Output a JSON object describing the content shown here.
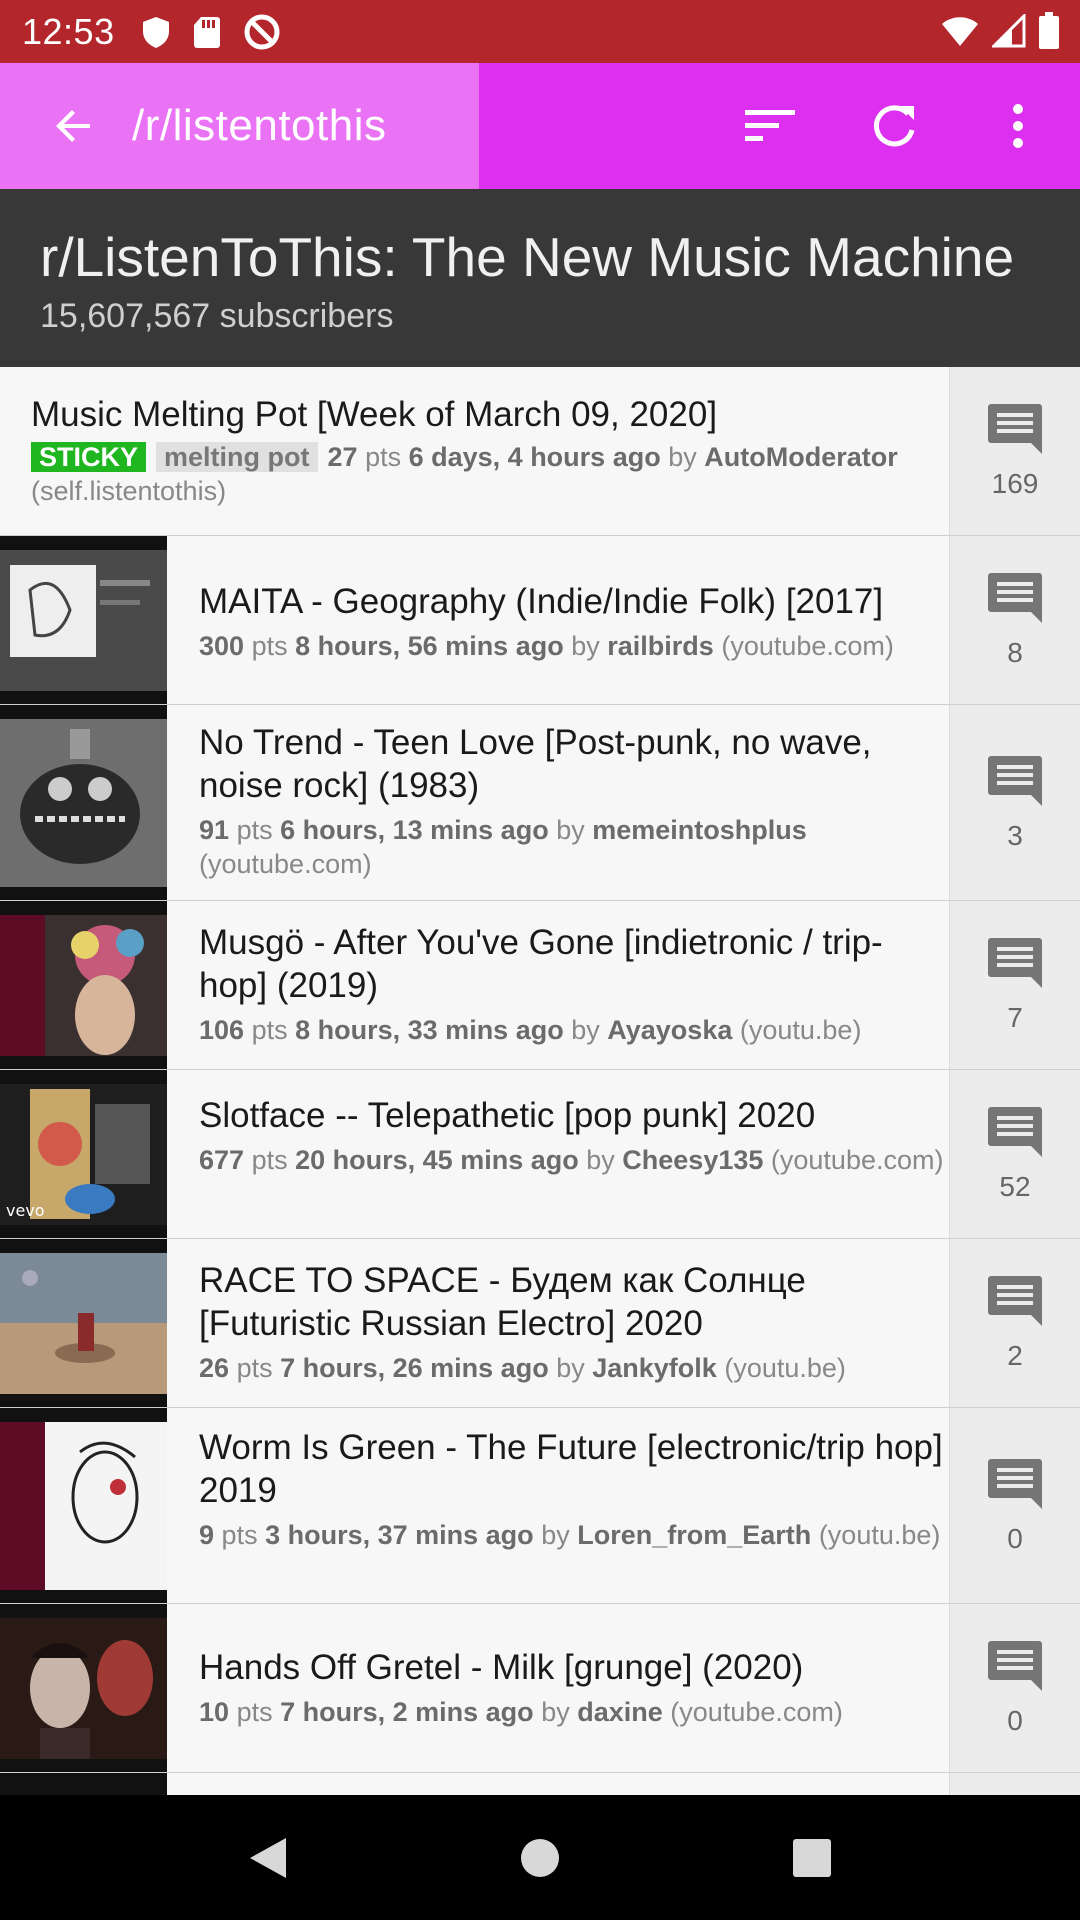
{
  "status_bar": {
    "time": "12:53"
  },
  "app_bar": {
    "title": "/r/listentothis"
  },
  "subreddit": {
    "title": "r/ListenToThis: The New Music Machine",
    "subscribers": "15,607,567 subscribers"
  },
  "posts": [
    {
      "title": "Music Melting Pot [Week of March 09, 2020]",
      "tag": "STICKY",
      "flair": "melting pot",
      "points": "27",
      "pts_label": "pts",
      "time": "6 days, 4 hours ago",
      "by": "by",
      "author": "AutoModerator",
      "domain": "(self.listentothis)",
      "comments": "169"
    },
    {
      "title": "MAITA - Geography (Indie/Indie Folk) [2017]",
      "points": "300",
      "pts_label": "pts",
      "time": "8 hours, 56 mins ago",
      "by": "by",
      "author": "railbirds",
      "domain": "(youtube.com)",
      "comments": "8"
    },
    {
      "title": "No Trend - Teen Love [Post-punk, no wave, noise rock] (1983)",
      "points": "91",
      "pts_label": "pts",
      "time": "6 hours, 13 mins ago",
      "by": "by",
      "author": "memeintoshplus",
      "domain": "(youtube.com)",
      "comments": "3"
    },
    {
      "title": "Musgö - After You've Gone [indietronic / trip-hop] (2019)",
      "points": "106",
      "pts_label": "pts",
      "time": "8 hours, 33 mins ago",
      "by": "by",
      "author": "Ayayoska",
      "domain": "(youtu.be)",
      "comments": "7"
    },
    {
      "title": "Slotface -- Telepathetic [pop punk] 2020",
      "points": "677",
      "pts_label": "pts",
      "time": "20 hours, 45 mins ago",
      "by": "by",
      "author": "Cheesy135",
      "domain": "(youtube.com)",
      "comments": "52"
    },
    {
      "title": "RACE TO SPACE - Будем как Солнце [Futuristic Russian Electro] 2020",
      "points": "26",
      "pts_label": "pts",
      "time": "7 hours, 26 mins ago",
      "by": "by",
      "author": "Jankyfolk",
      "domain": "(youtu.be)",
      "comments": "2"
    },
    {
      "title": "Worm Is Green - The Future [electronic/trip hop] 2019",
      "points": "9",
      "pts_label": "pts",
      "time": "3 hours, 37 mins ago",
      "by": "by",
      "author": "Loren_from_Earth",
      "domain": "(youtu.be)",
      "comments": "0"
    },
    {
      "title": "Hands Off Gretel - Milk [grunge] (2020)",
      "points": "10",
      "pts_label": "pts",
      "time": "7 hours, 2 mins ago",
      "by": "by",
      "author": "daxine",
      "domain": "(youtube.com)",
      "comments": "0"
    }
  ],
  "colors": {
    "status_bar": "#b3262b",
    "app_bar": "#dd2ff0",
    "app_bar_title_area": "#ea72f5",
    "header_bg": "#383838",
    "sticky_tag": "#1fb61f"
  },
  "icons": {
    "back": "arrow-back-icon",
    "sort": "sort-icon",
    "refresh": "refresh-icon",
    "more": "more-vert-icon",
    "comment": "comment-icon"
  }
}
